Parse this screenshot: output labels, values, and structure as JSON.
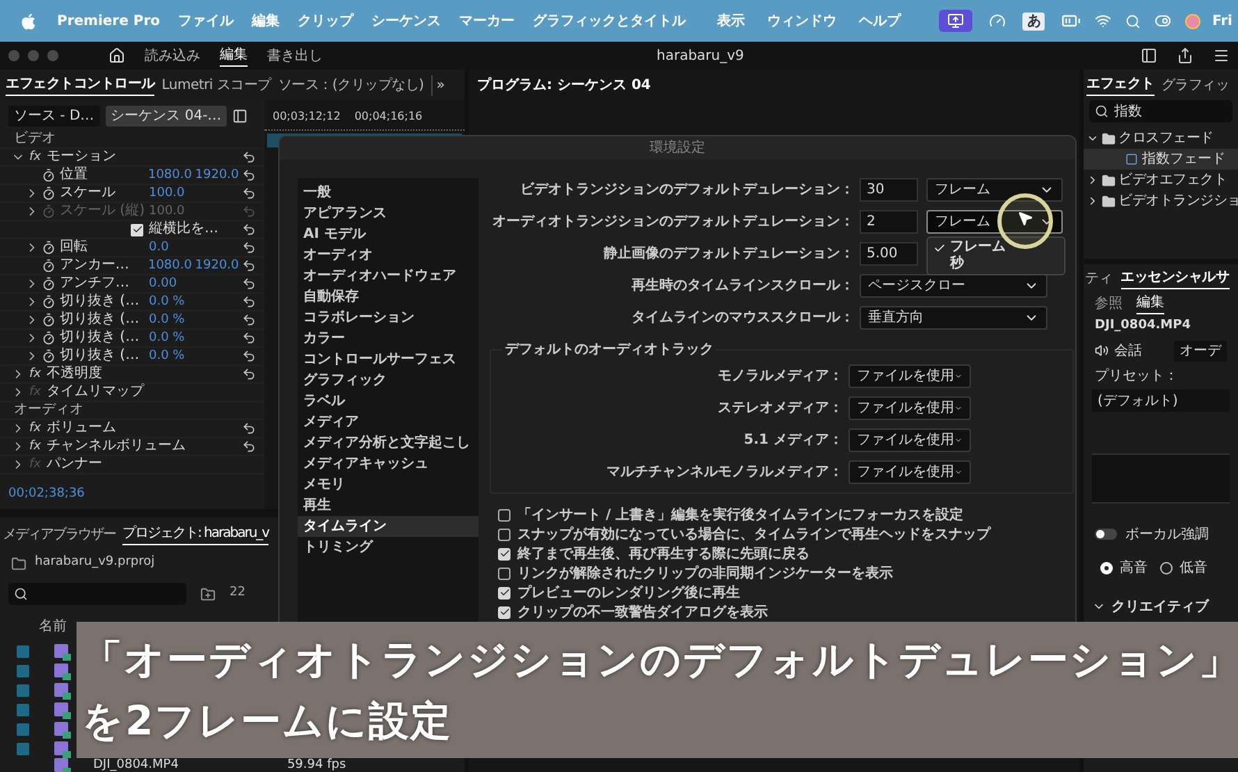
{
  "menubar": {
    "app": "Premiere Pro",
    "left_items": [
      "ファイル",
      "編集",
      "クリップ",
      "シーケンス",
      "マーカー",
      "グラフィックとタイトル"
    ],
    "right_items": [
      "表示",
      "ウィンドウ",
      "ヘルプ"
    ],
    "ime": "あ",
    "clock": "Fri"
  },
  "header": {
    "workspaces": [
      {
        "label": "読み込み",
        "selected": false
      },
      {
        "label": "編集",
        "selected": true
      },
      {
        "label": "書き出し",
        "selected": false
      }
    ],
    "title": "harabaru_v9"
  },
  "effect_controls": {
    "tabs": [
      {
        "label": "エフェクトコントロール",
        "selected": true
      },
      {
        "label": "Lumetri スコープ",
        "selected": false
      },
      {
        "label": "ソース：(クリップなし)",
        "selected": false
      }
    ],
    "more": "»",
    "source_button": "ソース - D…",
    "sequence_button": "シーケンス 04-…",
    "timecodes": [
      "00;03;12;12",
      "00;04;16;16"
    ],
    "rows": [
      {
        "kind": "section",
        "label": "ビデオ"
      },
      {
        "kind": "fx",
        "badge": "fx",
        "label": "モーション",
        "expanded": true,
        "enabled": true,
        "reset": true,
        "children": [
          {
            "kind": "param",
            "label": "位置",
            "values": [
              "1080.0",
              "1920.0"
            ],
            "collapsible": false,
            "disabled": false
          },
          {
            "kind": "param",
            "label": "スケール",
            "values": [
              "100.0"
            ],
            "collapsible": true,
            "disabled": false
          },
          {
            "kind": "param",
            "label": "スケール (縦)",
            "values": [
              "100.0"
            ],
            "collapsible": true,
            "disabled": true
          },
          {
            "kind": "checkbox",
            "label": "縦横比を…",
            "checked": true
          },
          {
            "kind": "param",
            "label": "回転",
            "values": [
              "0.0"
            ],
            "collapsible": true,
            "disabled": false
          },
          {
            "kind": "param",
            "label": "アンカー…",
            "values": [
              "1080.0",
              "1920.0"
            ],
            "collapsible": false,
            "disabled": false
          },
          {
            "kind": "param",
            "label": "アンチフ…",
            "values": [
              "0.00"
            ],
            "collapsible": true,
            "disabled": false
          },
          {
            "kind": "param",
            "label": "切り抜き (…",
            "values": [
              "0.0 %"
            ],
            "collapsible": true,
            "disabled": false
          },
          {
            "kind": "param",
            "label": "切り抜き (…",
            "values": [
              "0.0 %"
            ],
            "collapsible": true,
            "disabled": false
          },
          {
            "kind": "param",
            "label": "切り抜き (…",
            "values": [
              "0.0 %"
            ],
            "collapsible": true,
            "disabled": false
          },
          {
            "kind": "param",
            "label": "切り抜き (…",
            "values": [
              "0.0 %"
            ],
            "collapsible": true,
            "disabled": false
          }
        ]
      },
      {
        "kind": "fx",
        "badge": "fx",
        "label": "不透明度",
        "expanded": false,
        "enabled": true,
        "reset": true
      },
      {
        "kind": "fx",
        "badge": "fx",
        "label": "タイムリマップ",
        "expanded": false,
        "enabled": false,
        "reset": false
      },
      {
        "kind": "section",
        "label": "オーディオ"
      },
      {
        "kind": "fx",
        "badge": "fx",
        "label": "ボリューム",
        "expanded": false,
        "enabled": true,
        "reset": true
      },
      {
        "kind": "fx",
        "badge": "fx",
        "label": "チャンネルボリューム",
        "expanded": false,
        "enabled": true,
        "reset": true
      },
      {
        "kind": "fx",
        "badge": "fx",
        "label": "パンナー",
        "expanded": false,
        "enabled": false,
        "reset": false
      }
    ],
    "current_time": "00;02;38;36"
  },
  "program": {
    "title": "プログラム: シーケンス 04"
  },
  "project": {
    "tabs": [
      {
        "label": "メディアブラウザー",
        "selected": false
      },
      {
        "label": "プロジェクト: harabaru_v",
        "selected": true
      }
    ],
    "file": "harabaru_v9.prproj",
    "count": "22",
    "column_1": "名前",
    "rows": [
      {
        "kind": "covered"
      },
      {
        "kind": "covered"
      },
      {
        "kind": "covered"
      },
      {
        "kind": "covered"
      },
      {
        "kind": "covered"
      },
      {
        "kind": "covered"
      },
      {
        "kind": "file",
        "name": "DJI_0804.MP4",
        "rate": "59.94 fps"
      }
    ]
  },
  "effects": {
    "tabs": [
      {
        "label": "エフェクト",
        "selected": true
      },
      {
        "label": "グラフィッ",
        "selected": false
      }
    ],
    "search": "指数",
    "tree": [
      {
        "label": "クロスフェード",
        "expanded": true,
        "children": [
          {
            "label": "指数フェード",
            "selected": true
          }
        ]
      },
      {
        "label": "ビデオエフェクト",
        "expanded": false
      },
      {
        "label": "ビデオトランジショ",
        "expanded": false
      }
    ]
  },
  "essential_sound": {
    "tabs": [
      {
        "label": "ティ",
        "selected": false
      },
      {
        "label": "エッセンシャルサ",
        "selected": true
      }
    ],
    "subtabs": [
      {
        "label": "参照",
        "selected": false
      },
      {
        "label": "編集",
        "selected": true
      }
    ],
    "clip": "DJI_0804.MP4",
    "type": "会話",
    "type_button": "オーデ",
    "preset_label": "プリセット：",
    "preset": "(デフォルト)",
    "vocal": {
      "label": "ボーカル強調",
      "on": false
    },
    "radios": [
      {
        "label": "高音",
        "selected": true
      },
      {
        "label": "低音",
        "selected": false
      }
    ],
    "creative": {
      "label": "クリエイティブ",
      "expanded": true
    }
  },
  "dialog": {
    "title": "環境設定",
    "categories": [
      {
        "label": "一般",
        "selected": false
      },
      {
        "label": "アピアランス",
        "selected": false
      },
      {
        "label": "AI モデル",
        "selected": false
      },
      {
        "label": "オーディオ",
        "selected": false
      },
      {
        "label": "オーディオハードウェア",
        "selected": false
      },
      {
        "label": "自動保存",
        "selected": false
      },
      {
        "label": "コラボレーション",
        "selected": false
      },
      {
        "label": "カラー",
        "selected": false
      },
      {
        "label": "コントロールサーフェス",
        "selected": false
      },
      {
        "label": "グラフィック",
        "selected": false
      },
      {
        "label": "ラベル",
        "selected": false
      },
      {
        "label": "メディア",
        "selected": false
      },
      {
        "label": "メディア分析と文字起こし",
        "selected": false
      },
      {
        "label": "メディアキャッシュ",
        "selected": false
      },
      {
        "label": "メモリ",
        "selected": false
      },
      {
        "label": "再生",
        "selected": false
      },
      {
        "label": "タイムライン",
        "selected": true
      },
      {
        "label": "トリミング",
        "selected": false
      }
    ],
    "durations": [
      {
        "label": "ビデオトランジションのデフォルトデュレーション：",
        "value": "30",
        "unit": "フレーム",
        "open": false
      },
      {
        "label": "オーディオトランジションのデフォルトデュレーション：",
        "value": "2",
        "unit": "フレーム",
        "open": true
      },
      {
        "label": "静止画像のデフォルトデュレーション：",
        "value": "5.00"
      }
    ],
    "unit_menu": [
      {
        "label": "フレーム",
        "selected": true
      },
      {
        "label": "秒",
        "selected": false
      }
    ],
    "scrolls": [
      {
        "label": "再生時のタイムラインスクロール：",
        "value": "ページスクロー"
      },
      {
        "label": "タイムラインのマウススクロール：",
        "value": "垂直方向"
      }
    ],
    "audio_track": {
      "legend": "デフォルトのオーディオトラック",
      "rows": [
        {
          "label": "モノラルメディア：",
          "value": "ファイルを使用"
        },
        {
          "label": "ステレオメディア：",
          "value": "ファイルを使用"
        },
        {
          "label": "5.1 メディア：",
          "value": "ファイルを使用"
        },
        {
          "label": "マルチチャンネルモノラルメディア：",
          "value": "ファイルを使用"
        }
      ]
    },
    "options": [
      {
        "label": "「インサート / 上書き」編集を実行後タイムラインにフォーカスを設定",
        "checked": false
      },
      {
        "label": "スナップが有効になっている場合に、タイムラインで再生ヘッドをスナップ",
        "checked": false
      },
      {
        "label": "終了まで再生後、再び再生する際に先頭に戻る",
        "checked": true
      },
      {
        "label": "リンクが解除されたクリップの非同期インジケーターを表示",
        "checked": false
      },
      {
        "label": "プレビューのレンダリング後に再生",
        "checked": true
      },
      {
        "label": "クリップの不一致警告ダイアログを表示",
        "checked": true
      }
    ]
  },
  "caption": {
    "lines": [
      "「オーディオトランジションのデフォルトデュレーション」",
      "を2フレームに設定"
    ]
  }
}
